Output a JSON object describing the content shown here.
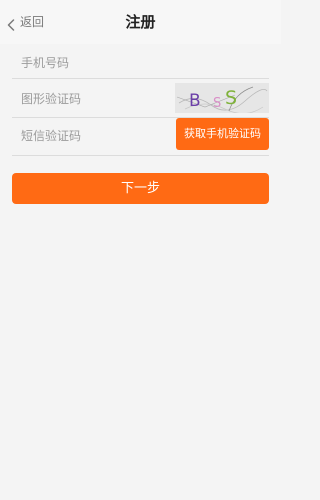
{
  "header": {
    "back_label": "返回",
    "title": "注册"
  },
  "form": {
    "phone_placeholder": "手机号码",
    "captcha_placeholder": "图形验证码",
    "sms_placeholder": "短信验证码",
    "captcha_text": [
      "B",
      "S",
      "S"
    ],
    "captcha_colors": [
      "#6b3fa8",
      "#d98fc7",
      "#7fb23a"
    ],
    "sms_button_label": "获取手机验证码",
    "next_button_label": "下一步"
  },
  "colors": {
    "accent": "#ff6a14"
  }
}
